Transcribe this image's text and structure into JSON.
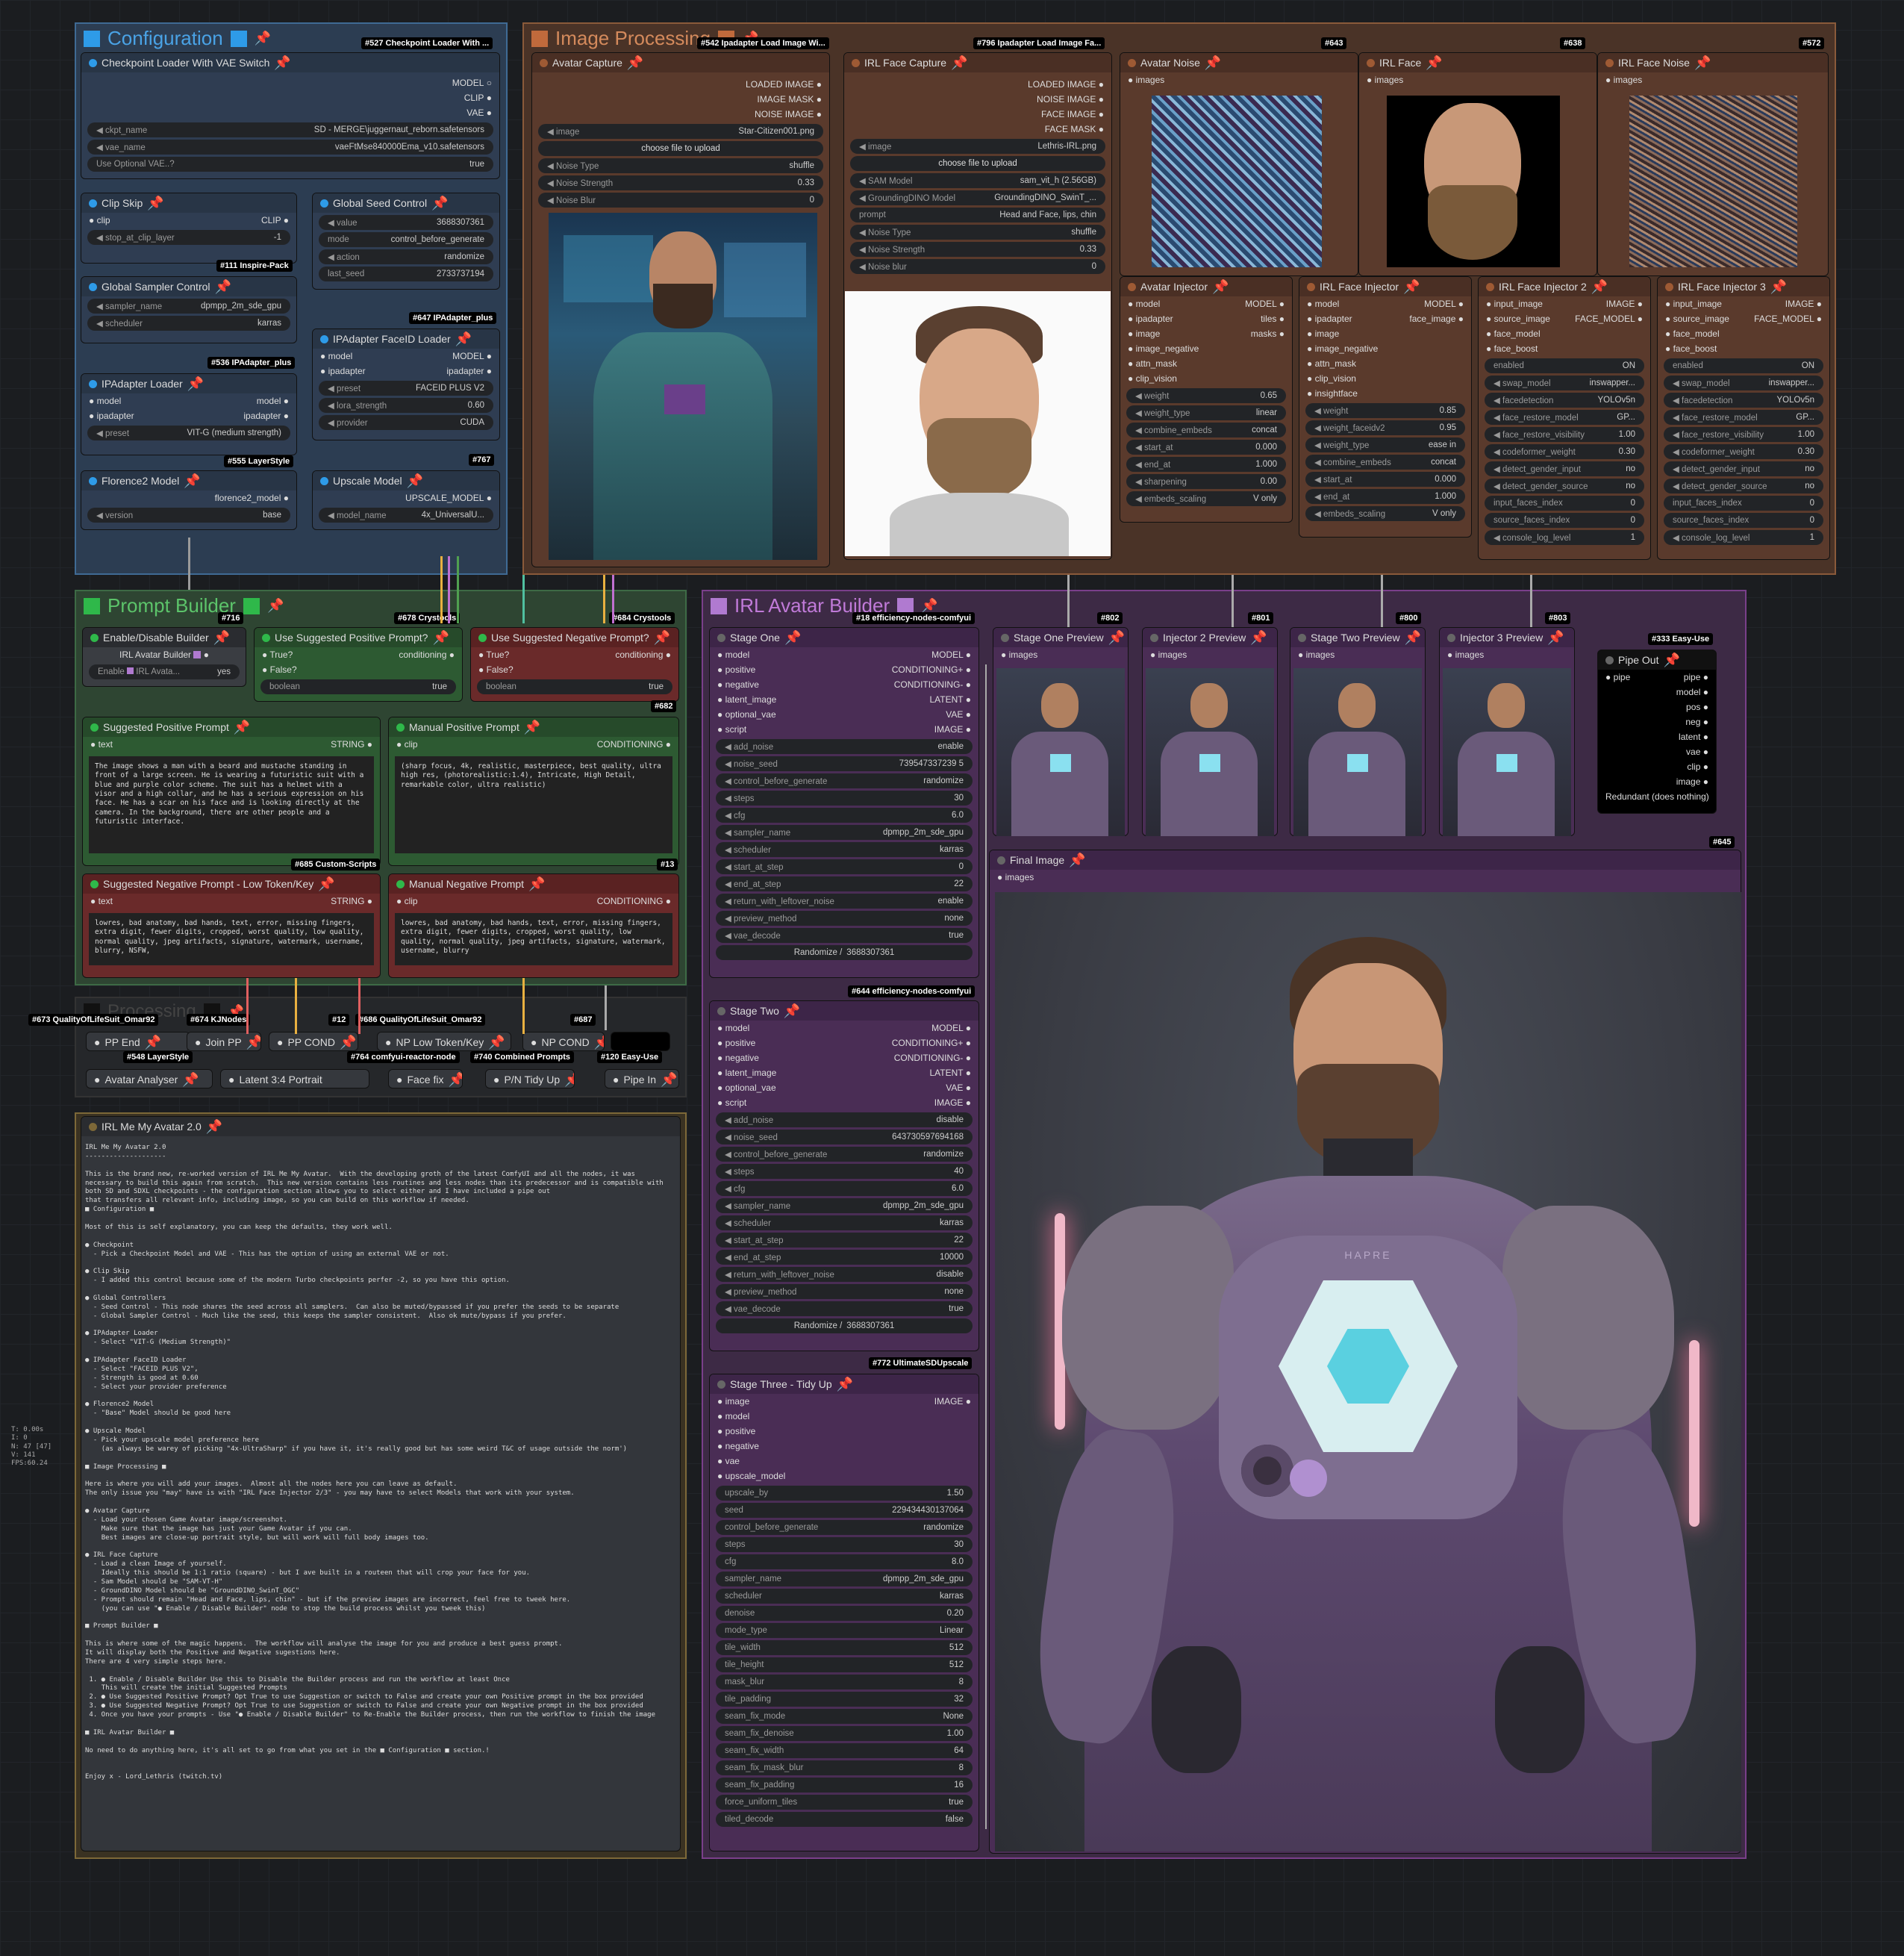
{
  "groups": {
    "configuration": "Configuration",
    "image_processing": "Image Processing",
    "prompt_builder": "Prompt Builder",
    "irl_avatar_builder": "IRL Avatar Builder",
    "processing": "Processing"
  },
  "tags": {
    "t527": "#527 Checkpoint Loader With ...",
    "t542": "#542 Ipadapter Load Image Wi...",
    "t796": "#796 Ipadapter Load Image Fa...",
    "t643": "#643",
    "t638": "#638",
    "t572": "#572",
    "t111": "#111 Inspire-Pack",
    "t647": "#647 IPAdapter_plus",
    "t536": "#536 IPAdapter_plus",
    "t555": "#555 LayerStyle",
    "t767": "#767",
    "t716": "#716",
    "t678": "#678 Crystools",
    "t684": "#684 Crystools",
    "t682": "#682",
    "t685": "#685 Custom-Scripts",
    "t13": "#13",
    "t18": "#18 efficiency-nodes-comfyui",
    "t802": "#802",
    "t801": "#801",
    "t800": "#800",
    "t803": "#803",
    "t333": "#333 Easy-Use",
    "t645": "#645",
    "t644": "#644 efficiency-nodes-comfyui",
    "t772": "#772 UltimateSDUpscale",
    "t673": "#673 QualityOfLifeSuit_Omar92",
    "t674": "#674 KJNodes",
    "t12": "#12",
    "t686": "#686 QualityOfLifeSuit_Omar92",
    "t687": "#687",
    "t548": "#548 LayerStyle",
    "t764": "#764 comfyui-reactor-node",
    "t740": "#740 Combined Prompts",
    "t120": "#120 Easy-Use"
  },
  "ckpt": {
    "title": "Checkpoint Loader With VAE Switch",
    "out_model": "MODEL",
    "out_clip": "CLIP",
    "out_vae": "VAE",
    "w1l": "ckpt_name",
    "w1v": "SD - MERGE\\juggernaut_reborn.safetensors",
    "w2l": "vae_name",
    "w2v": "vaeFtMse840000Ema_v10.safetensors",
    "w3l": "Use Optional VAE..?",
    "w3v": "true"
  },
  "clipskip": {
    "title": "Clip Skip",
    "in": "clip",
    "out": "CLIP",
    "wl": "stop_at_clip_layer",
    "wv": "-1"
  },
  "seed": {
    "title": "Global Seed Control",
    "w1l": "value",
    "w1v": "3688307361",
    "w2l": "mode",
    "w2v": "control_before_generate",
    "w3l": "action",
    "w3v": "randomize",
    "w4l": "last_seed",
    "w4v": "2733737194"
  },
  "sampler": {
    "title": "Global Sampler Control",
    "w1l": "sampler_name",
    "w1v": "dpmpp_2m_sde_gpu",
    "w2l": "scheduler",
    "w2v": "karras"
  },
  "faceid": {
    "title": "IPAdapter FaceID Loader",
    "in1": "model",
    "in2": "ipadapter",
    "out1": "MODEL",
    "out2": "ipadapter",
    "w1l": "preset",
    "w1v": "FACEID PLUS V2",
    "w2l": "lora_strength",
    "w2v": "0.60",
    "w3l": "provider",
    "w3v": "CUDA"
  },
  "ipaload": {
    "title": "IPAdapter Loader",
    "in1": "model",
    "in2": "ipadapter",
    "out1": "model",
    "out2": "ipadapter",
    "wl": "preset",
    "wv": "VIT-G (medium strength)"
  },
  "florence": {
    "title": "Florence2 Model",
    "out": "florence2_model",
    "wl": "version",
    "wv": "base"
  },
  "upscale": {
    "title": "Upscale Model",
    "out": "UPSCALE_MODEL",
    "wl": "model_name",
    "wv": "4x_UniversalU..."
  },
  "avatar_capture": {
    "title": "Avatar Capture",
    "o1": "LOADED IMAGE",
    "o2": "IMAGE MASK",
    "o3": "NOISE IMAGE",
    "w1l": "image",
    "w1v": "Star-Citizen001.png",
    "btn": "choose file to upload",
    "w2l": "Noise Type",
    "w2v": "shuffle",
    "w3l": "Noise Strength",
    "w3v": "0.33",
    "w4l": "Noise Blur",
    "w4v": "0"
  },
  "face_capture": {
    "title": "IRL Face Capture",
    "o1": "LOADED IMAGE",
    "o2": "NOISE IMAGE",
    "o3": "FACE IMAGE",
    "o4": "FACE MASK",
    "w1l": "image",
    "w1v": "Lethris-IRL.png",
    "btn": "choose file to upload",
    "w2l": "SAM Model",
    "w2v": "sam_vit_h (2.56GB)",
    "w3l": "GroundingDINO Model",
    "w3v": "GroundingDINO_SwinT_...",
    "w4l": "prompt",
    "w4v": "Head and Face, lips, chin",
    "w5l": "Noise Type",
    "w5v": "shuffle",
    "w6l": "Noise Strength",
    "w6v": "0.33",
    "w7l": "Noise blur",
    "w7v": "0"
  },
  "avatar_noise": {
    "title": "Avatar Noise",
    "in": "images"
  },
  "irl_face": {
    "title": "IRL Face",
    "in": "images"
  },
  "irl_face_noise": {
    "title": "IRL Face Noise",
    "in": "images"
  },
  "avatar_injector": {
    "title": "Avatar Injector",
    "i1": "model",
    "i2": "ipadapter",
    "i3": "image",
    "i4": "image_negative",
    "i5": "attn_mask",
    "i6": "clip_vision",
    "o1": "MODEL",
    "o2": "tiles",
    "o3": "masks",
    "w1l": "weight",
    "w1v": "0.65",
    "w2l": "weight_type",
    "w2v": "linear",
    "w3l": "combine_embeds",
    "w3v": "concat",
    "w4l": "start_at",
    "w4v": "0.000",
    "w5l": "end_at",
    "w5v": "1.000",
    "w6l": "sharpening",
    "w6v": "0.00",
    "w7l": "embeds_scaling",
    "w7v": "V only"
  },
  "face_injector": {
    "title": "IRL Face Injector",
    "i1": "model",
    "i2": "ipadapter",
    "i3": "image",
    "i4": "image_negative",
    "i5": "attn_mask",
    "i6": "clip_vision",
    "i7": "insightface",
    "o1": "MODEL",
    "o2": "face_image",
    "w1l": "weight",
    "w1v": "0.85",
    "w2l": "weight_faceidv2",
    "w2v": "0.95",
    "w3l": "weight_type",
    "w3v": "ease in",
    "w4l": "combine_embeds",
    "w4v": "concat",
    "w5l": "start_at",
    "w5v": "0.000",
    "w6l": "end_at",
    "w6v": "1.000",
    "w7l": "embeds_scaling",
    "w7v": "V only"
  },
  "face_injector2": {
    "title": "IRL Face Injector 2",
    "i1": "input_image",
    "i2": "source_image",
    "i3": "face_model",
    "i4": "face_boost",
    "o1": "IMAGE",
    "o2": "FACE_MODEL",
    "w1l": "enabled",
    "w1v": "ON",
    "w2l": "swap_model",
    "w2v": "inswapper...",
    "w3l": "facedetection",
    "w3v": "YOLOv5n",
    "w4l": "face_restore_model",
    "w4v": "GP...",
    "w5l": "face_restore_visibility",
    "w5v": "1.00",
    "w6l": "codeformer_weight",
    "w6v": "0.30",
    "w7l": "detect_gender_input",
    "w7v": "no",
    "w8l": "detect_gender_source",
    "w8v": "no",
    "w9l": "input_faces_index",
    "w9v": "0",
    "w10l": "source_faces_index",
    "w10v": "0",
    "w11l": "console_log_level",
    "w11v": "1"
  },
  "face_injector3": {
    "title": "IRL Face Injector 3",
    "w4v": "GP...",
    "w5v": "1.00"
  },
  "enable": {
    "title": "Enable/Disable Builder",
    "label": "IRL Avatar Builder",
    "wl": "Enable",
    "wl2": "IRL Avata...",
    "wv": "yes"
  },
  "use_pos": {
    "title": "Use Suggested Positive Prompt?",
    "i1": "True?",
    "i2": "False?",
    "out": "conditioning",
    "wl": "boolean",
    "wv": "true"
  },
  "use_neg": {
    "title": "Use Suggested Negative Prompt?",
    "i1": "True?",
    "i2": "False?",
    "out": "conditioning",
    "wl": "boolean",
    "wv": "true"
  },
  "sugg_pos": {
    "title": "Suggested Positive Prompt",
    "in": "text",
    "out": "STRING",
    "text": "The image shows a man with a beard and mustache standing in front of a large screen. He is wearing a futuristic suit with a blue and purple color scheme. The suit has a helmet with a visor and a high collar, and he has a serious expression on his face. He has a scar on his face and is looking directly at the camera. In the background, there are other people and a futuristic interface."
  },
  "manual_pos": {
    "title": "Manual Positive Prompt",
    "in": "clip",
    "out": "CONDITIONING",
    "text": "(sharp focus, 4k, realistic, masterpiece, best quality, ultra high res, (photorealistic:1.4), Intricate, High Detail, remarkable color, ultra realistic)"
  },
  "sugg_neg": {
    "title": "Suggested Negative Prompt - Low Token/Key",
    "in": "text",
    "out": "STRING",
    "text": "lowres, bad anatomy, bad hands, text, error, missing fingers, extra digit, fewer digits, cropped, worst quality, low quality, normal quality, jpeg artifacts, signature, watermark, username, blurry, NSFW,"
  },
  "manual_neg": {
    "title": "Manual Negative Prompt",
    "in": "clip",
    "out": "CONDITIONING",
    "text": "lowres, bad anatomy, bad hands, text, error, missing fingers, extra digit, fewer digits, cropped, worst quality, low quality, normal quality, jpeg artifacts, signature, watermark, username, blurry"
  },
  "proc": {
    "pp_end": "PP End",
    "join_pp": "Join PP",
    "pp_cond": "PP COND",
    "np_low": "NP Low Token/Key",
    "np_cond": "NP COND",
    "avatar_an": "Avatar Analyser",
    "latent": "Latent 3:4 Portrait",
    "face_fix": "Face fix",
    "pn_tidy": "P/N Tidy Up",
    "pipe_in": "Pipe In"
  },
  "stage1": {
    "title": "Stage One",
    "i1": "model",
    "i2": "positive",
    "i3": "negative",
    "i4": "latent_image",
    "i5": "optional_vae",
    "i6": "script",
    "o1": "MODEL",
    "o2": "CONDITIONING+",
    "o3": "CONDITIONING-",
    "o4": "LATENT",
    "o5": "VAE",
    "o6": "IMAGE",
    "w1l": "add_noise",
    "w1v": "enable",
    "w2l": "noise_seed",
    "w2v": "739547337239 5",
    "w3l": "control_before_generate",
    "w3v": "randomize",
    "w4l": "steps",
    "w4v": "30",
    "w5l": "cfg",
    "w5v": "6.0",
    "w6l": "sampler_name",
    "w6v": "dpmpp_2m_sde_gpu",
    "w7l": "scheduler",
    "w7v": "karras",
    "w8l": "start_at_step",
    "w8v": "0",
    "w9l": "end_at_step",
    "w9v": "22",
    "w10l": "return_with_leftover_noise",
    "w10v": "enable",
    "w11l": "preview_method",
    "w11v": "none",
    "w12l": "vae_decode",
    "w12v": "true",
    "btn": "Randomize /",
    "seed": "3688307361"
  },
  "stage2": {
    "title": "Stage Two",
    "w1v": "disable",
    "w2v": "643730597694168",
    "w3v": "randomize",
    "w4v": "40",
    "w5v": "6.0",
    "w6v": "dpmpp_2m_sde_gpu",
    "w7v": "karras",
    "w8v": "22",
    "w9v": "10000",
    "w10v": "disable",
    "w11v": "none",
    "w12v": "true"
  },
  "stage3": {
    "title": "Stage Three - Tidy Up",
    "i1": "image",
    "i2": "model",
    "i3": "positive",
    "i4": "negative",
    "i5": "vae",
    "i6": "upscale_model",
    "out": "IMAGE",
    "w": [
      [
        "upscale_by",
        "1.50"
      ],
      [
        "seed",
        "229434430137064"
      ],
      [
        "control_before_generate",
        "randomize"
      ],
      [
        "steps",
        "30"
      ],
      [
        "cfg",
        "8.0"
      ],
      [
        "sampler_name",
        "dpmpp_2m_sde_gpu"
      ],
      [
        "scheduler",
        "karras"
      ],
      [
        "denoise",
        "0.20"
      ],
      [
        "mode_type",
        "Linear"
      ],
      [
        "tile_width",
        "512"
      ],
      [
        "tile_height",
        "512"
      ],
      [
        "mask_blur",
        "8"
      ],
      [
        "tile_padding",
        "32"
      ],
      [
        "seam_fix_mode",
        "None"
      ],
      [
        "seam_fix_denoise",
        "1.00"
      ],
      [
        "seam_fix_width",
        "64"
      ],
      [
        "seam_fix_mask_blur",
        "8"
      ],
      [
        "seam_fix_padding",
        "16"
      ],
      [
        "force_uniform_tiles",
        "true"
      ],
      [
        "tiled_decode",
        "false"
      ]
    ]
  },
  "previews": {
    "p1": "Stage One Preview",
    "p2": "Injector 2 Preview",
    "p3": "Stage Two Preview",
    "p4": "Injector 3 Preview",
    "in": "images"
  },
  "pipe_out": {
    "title": "Pipe Out",
    "in": "pipe",
    "o1": "pipe",
    "o2": "model",
    "o3": "pos",
    "o4": "neg",
    "o5": "latent",
    "o6": "vae",
    "o7": "clip",
    "o8": "image",
    "redundant": "Redundant (does nothing)"
  },
  "final": {
    "title": "Final Image",
    "in": "images",
    "chest": "HAPRE"
  },
  "notes": {
    "title": "IRL Me My Avatar 2.0",
    "text": "IRL Me My Avatar 2.0\n--------------------\n\nThis is the brand new, re-worked version of IRL Me My Avatar.  With the developing groth of the latest ComfyUI and all the nodes, it was\nnecessary to build this again from scratch.  This new version contains less routines and less nodes than its predecessor and is compatible with\nboth SD and SDXL checkpoints - the configuration section allows you to select either and I have included a pipe out\nthat transfers all relevant info, including image, so you can build on this workflow if needed.\n■ Configuration ■\n\nMost of this is self explanatory, you can keep the defaults, they work well.\n\n● Checkpoint\n  - Pick a Checkpoint Model and VAE - This has the option of using an external VAE or not.\n\n● Clip Skip\n  - I added this control because some of the modern Turbo checkpoints perfer -2, so you have this option.\n\n● Global Controllers\n  - Seed Control - This node shares the seed across all samplers.  Can also be muted/bypassed if you prefer the seeds to be separate\n  - Global Sampler Control - Much like the seed, this keeps the sampler consistent.  Also ok mute/bypass if you prefer.\n\n● IPAdapter Loader\n  - Select \"VIT-G (Medium Strength)\"\n\n● IPAdapter FaceID Loader\n  - Select \"FACEID PLUS V2\",\n  - Strength is good at 0.60\n  - Select your provider preference\n\n● Florence2 Model\n  - \"Base\" Model should be good here\n\n● Upscale Model\n  - Pick your upscale model preference here\n    (as always be warey of picking \"4x-UltraSharp\" if you have it, it's really good but has some weird T&C of usage outside the norm')\n\n■ Image Processing ■\n\nHere is where you will add your images.  Almost all the nodes here you can leave as default.\nThe only issue you \"may\" have is with \"IRL Face Injector 2/3\" - you may have to select Models that work with your system.\n\n● Avatar Capture\n  - Load your chosen Game Avatar image/screenshot.\n    Make sure that the image has just your Game Avatar if you can.\n    Best images are close-up portrait style, but will work will full body images too.\n\n● IRL Face Capture\n  - Load a clean Image of yourself.\n    Ideally this should be 1:1 ratio (square) - but I ave built in a routeen that will crop your face for you.\n  - Sam Model should be \"SAM-VT-H\"\n  - GroundDINO Model should be \"GroundDINO_SwinT_OGC\"\n  - Prompt should remain \"Head and Face, lips, chin\" - but if the preview images are incorrect, feel free to tweek here.\n    (you can use \"● Enable / Disable Builder\" node to stop the build process whilst you tweek this)\n\n■ Prompt Builder ■\n\nThis is where some of the magic happens.  The workflow will analyse the image for you and produce a best guess prompt.\nIt will display both the Positive and Negative sugestions here.\nThere are 4 very simple steps here.\n\n 1. ● Enable / Disable Builder Use this to Disable the Builder process and run the workflow at least Once\n    This will create the initial Suggested Prompts\n 2. ● Use Suggested Positive Prompt? Opt True to use Suggestion or switch to False and create your own Positive prompt in the box provided\n 3. ● Use Suggested Negative Prompt? Opt True to use Suggestion or switch to False and create your own Negative prompt in the box provided\n 4. Once you have your prompts - Use \"● Enable / Disable Builder\" to Re-Enable the Builder process, then run the workflow to finish the image\n\n■ IRL Avatar Builder ■\n\nNo need to do anything here, it's all set to go from what you set in the ■ Configuration ■ section.!\n\n\nEnjoy x - Lord_Lethris (twitch.tv)"
  },
  "stats": {
    "t": "T: 0.00s",
    "i": "I: 0",
    "n": "N: 47 [47]",
    "v": "V: 141",
    "fps": "FPS:60.24"
  },
  "colors": {
    "config_group": "#2b6b9e",
    "image_group": "#9e5a34",
    "prompt_group": "#3d8a4a",
    "avatar_group": "#8a3fa0",
    "notes_group": "#7d6838"
  }
}
